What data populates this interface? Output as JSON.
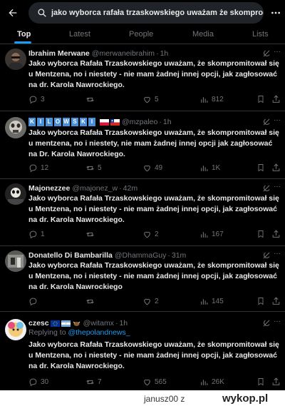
{
  "search": {
    "query": "jako wyborca rafała trzaskowskiego uważam że skompromitov"
  },
  "tabs": [
    "Top",
    "Latest",
    "People",
    "Media",
    "Lists"
  ],
  "tweets": [
    {
      "name": "Ibrahim Merwane",
      "handle": "@merwaneibrahim",
      "time": "1h",
      "text": "Jako wyborca Rafała Trzaskowskiego uważam, że skompromitował się u Mentzena, no i niestety - nie mam żadnej innej opcji, jak zagłosować na dr. Karola Nawrockiego.",
      "replies": "3",
      "retweets": "",
      "likes": "5",
      "views": "812"
    },
    {
      "name": "KILOWSKI",
      "handle": "@mzpaleo",
      "time": "1h",
      "text": "Jako wyborca Rafała Trzaskowskiego uważam, że skompromitował się u mentzena, no i niestety, nie mam żadnej innej opcji jak zagłosować na Dr. Karola Nawrockiego.",
      "replies": "12",
      "retweets": "5",
      "likes": "49",
      "views": "1K"
    },
    {
      "name": "Majonezzee",
      "handle": "@majonez_w",
      "time": "42m",
      "text": "Jako wyborca Rafała Trzaskowskiego uważam, że skompromitował się u Mentzena, no i niestety - nie mam żadnej innej opcji, jak zagłosować na dr. Karola Nawrockiego.",
      "replies": "1",
      "retweets": "",
      "likes": "2",
      "views": "167"
    },
    {
      "name": "Donatello Di Bambarilla",
      "handle": "@DhammaGuy",
      "time": "31m",
      "text": "Jako wyborca Rafała Trzaskowskiego uważam, że skompromitował się u Mentzena, no i niestety - nie mam żadnej innej opcji, jak zagłosować na dr. Karola Nawrockiego",
      "replies": "",
      "retweets": "",
      "likes": "2",
      "views": "145"
    },
    {
      "name": "czesc",
      "handle": "@witamx",
      "time": "1h",
      "reply_prefix": "Replying to",
      "reply_to": "@thepolandnews_",
      "text": "Jako wyborca Rafała Trzaskowskiego uważam, że skompromitował się u Mentzena, no i niestety - nie mam żadnej innej opcji, jak zagłosować na dr. Karola Nawrockiego.",
      "replies": "30",
      "retweets": "7",
      "likes": "565",
      "views": "26K"
    }
  ],
  "footer": {
    "user": "janusz00",
    "separator": "z",
    "site": "wykop.pl"
  },
  "colors": {
    "accent": "#1d9bf0",
    "muted": "#71767b",
    "text": "#e7e9ea",
    "divider": "#2f3336"
  }
}
